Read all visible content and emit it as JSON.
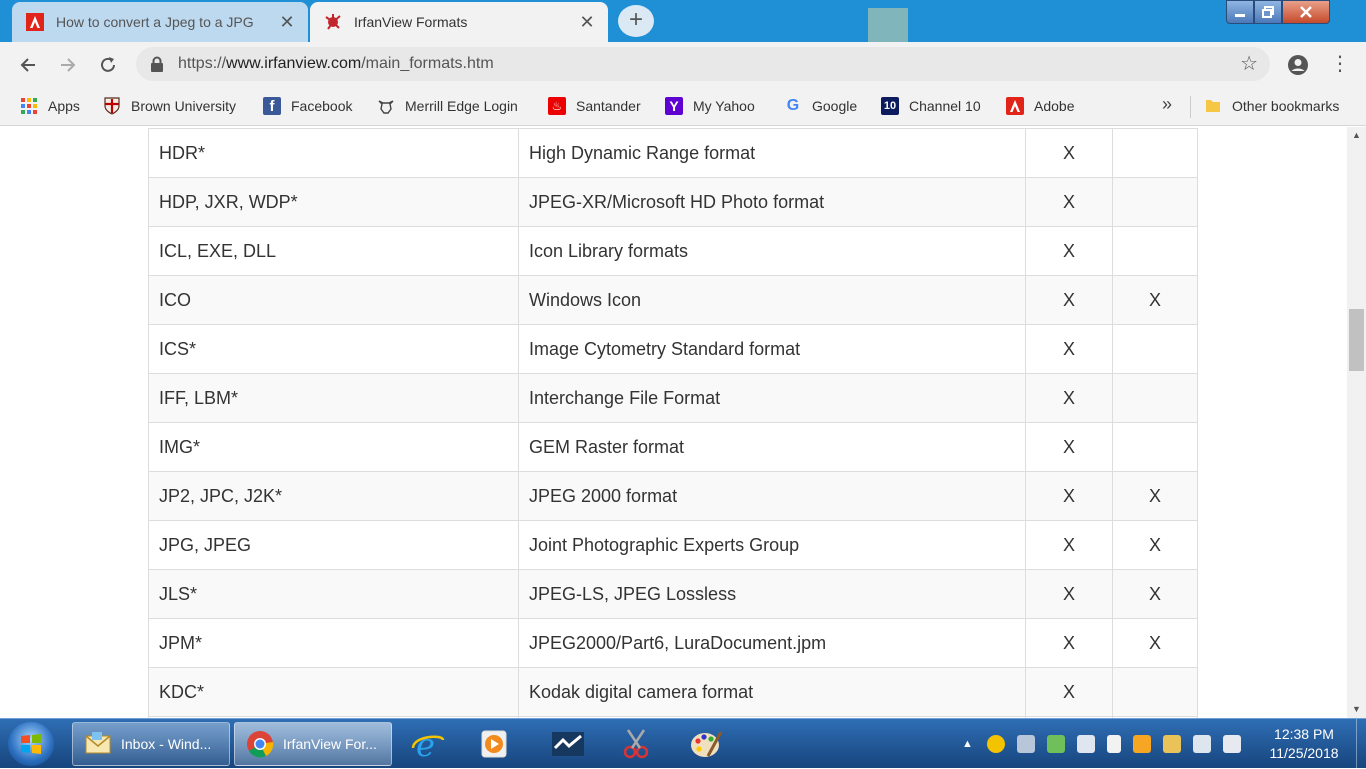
{
  "browser": {
    "tabs": [
      {
        "title": "How to convert a Jpeg to a JPG",
        "active": false
      },
      {
        "title": "IrfanView Formats",
        "active": true
      }
    ],
    "new_tab_symbol": "+",
    "url_scheme": "https://",
    "url_host": "www.irfanview.com",
    "url_path": "/main_formats.htm"
  },
  "bookmarks": {
    "items": [
      {
        "label": "Apps",
        "icon": "apps-grid-icon"
      },
      {
        "label": "Brown University",
        "icon": "brown-shield-icon"
      },
      {
        "label": "Facebook",
        "icon": "facebook-icon"
      },
      {
        "label": "Merrill Edge Login",
        "icon": "merrill-bull-icon"
      },
      {
        "label": "Santander",
        "icon": "santander-flame-icon"
      },
      {
        "label": "My Yahoo",
        "icon": "yahoo-icon"
      },
      {
        "label": "Google",
        "icon": "google-icon"
      },
      {
        "label": "Channel 10",
        "icon": "channel10-icon"
      },
      {
        "label": "Adobe",
        "icon": "adobe-icon"
      }
    ],
    "overflow": "»",
    "other": "Other bookmarks"
  },
  "formats_table": {
    "rows": [
      {
        "ext": "HDR*",
        "desc": "High Dynamic Range format",
        "read": "X",
        "write": ""
      },
      {
        "ext": "HDP, JXR, WDP*",
        "desc": "JPEG-XR/Microsoft HD Photo format",
        "read": "X",
        "write": ""
      },
      {
        "ext": "ICL, EXE, DLL",
        "desc": "Icon Library formats",
        "read": "X",
        "write": ""
      },
      {
        "ext": "ICO",
        "desc": "Windows Icon",
        "read": "X",
        "write": "X"
      },
      {
        "ext": "ICS*",
        "desc": "Image Cytometry Standard format",
        "read": "X",
        "write": ""
      },
      {
        "ext": "IFF, LBM*",
        "desc": "Interchange File Format",
        "read": "X",
        "write": ""
      },
      {
        "ext": "IMG*",
        "desc": "GEM Raster format",
        "read": "X",
        "write": ""
      },
      {
        "ext": "JP2, JPC, J2K*",
        "desc": "JPEG 2000 format",
        "read": "X",
        "write": "X"
      },
      {
        "ext": "JPG, JPEG",
        "desc": "Joint Photographic Experts Group",
        "read": "X",
        "write": "X"
      },
      {
        "ext": "JLS*",
        "desc": "JPEG-LS, JPEG Lossless",
        "read": "X",
        "write": "X"
      },
      {
        "ext": "JPM*",
        "desc": "JPEG2000/Part6, LuraDocument.jpm",
        "read": "X",
        "write": "X"
      },
      {
        "ext": "KDC*",
        "desc": "Kodak digital camera format",
        "read": "X",
        "write": ""
      },
      {
        "ext": "",
        "desc": "",
        "read": "",
        "write": ""
      }
    ]
  },
  "taskbar": {
    "buttons": [
      {
        "label": "Inbox - Wind...",
        "icon": "mail-icon"
      },
      {
        "label": "IrfanView For...",
        "icon": "chrome-icon"
      }
    ],
    "clock_time": "12:38 PM",
    "clock_date": "11/25/2018"
  },
  "colors": {
    "tab_strip": "#1f8fd6",
    "toolbar": "#f2f2f2",
    "table_border": "#dddddd",
    "taskbar": "#17457e"
  }
}
